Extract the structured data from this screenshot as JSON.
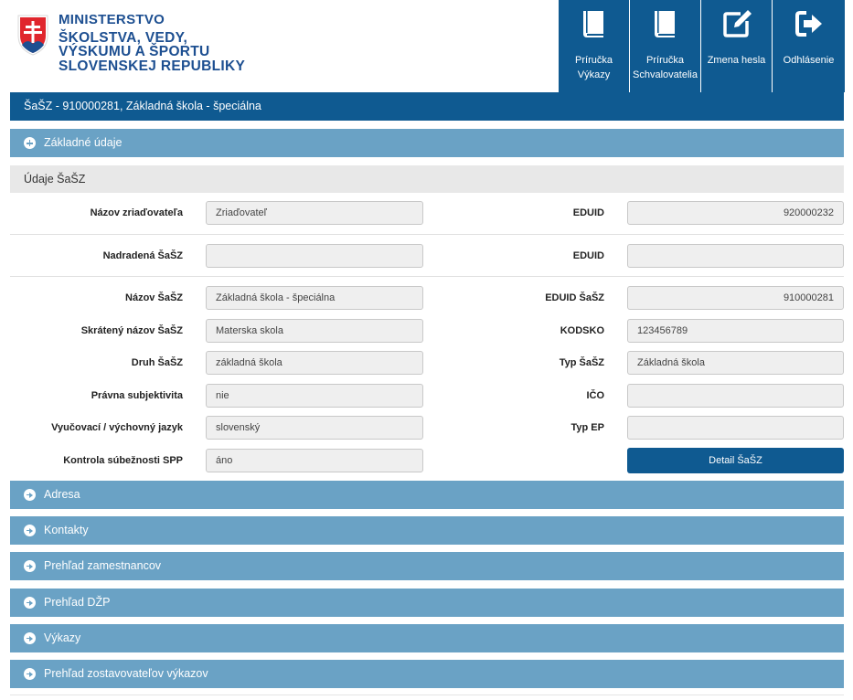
{
  "logo": {
    "line1": "MINISTERSTVO",
    "line2": "ŠKOLSTVA, VEDY,",
    "line3": "VÝSKUMU A ŠPORTU",
    "line4": "SLOVENSKEJ REPUBLIKY",
    "icon": "coat-of-arms-icon"
  },
  "topnav": [
    {
      "label1": "Príručka",
      "label2": "Výkazy",
      "icon": "book-icon"
    },
    {
      "label1": "Príručka",
      "label2": "Schvalovatelia",
      "icon": "book-icon"
    },
    {
      "label1": "Zmena hesla",
      "label2": "",
      "icon": "edit-icon"
    },
    {
      "label1": "Odhlásenie",
      "label2": "",
      "icon": "logout-icon"
    }
  ],
  "title": "ŠaŠZ - 910000281, Základná škola - špeciálna",
  "accordion_top": "Základné údaje",
  "section_title": "Údaje ŠaŠZ",
  "rows": {
    "zriad_label": "Názov zriaďovateľa",
    "zriad_value": "Zriaďovateľ",
    "euid1_label": "EDUID",
    "euid1_value": "920000232",
    "nadr_label": "Nadradená ŠaŠZ",
    "nadr_value": "",
    "euid2_label": "EDUID",
    "euid2_value": "",
    "nazov_label": "Názov ŠaŠZ",
    "nazov_value": "Základná škola - špeciálna",
    "euid3_label": "EDUID ŠaŠZ",
    "euid3_value": "910000281",
    "skrat_label": "Skrátený názov ŠaŠZ",
    "skrat_value": "Materska skola",
    "kodsko_label": "KODSKO",
    "kodsko_value": "123456789",
    "druh_label": "Druh ŠaŠZ",
    "druh_value": "základná škola",
    "typ_label": "Typ ŠaŠZ",
    "typ_value": "Základná škola",
    "pravna_label": "Právna subjektivita",
    "pravna_value": "nie",
    "ico_label": "IČO",
    "ico_value": "",
    "jazyk_label": "Vyučovací / výchovný jazyk",
    "jazyk_value": "slovenský",
    "typep_label": "Typ EP",
    "typep_value": "",
    "kontrola_label": "Kontrola súbežnosti SPP",
    "kontrola_value": "áno",
    "detail_button": "Detail ŠaŠZ"
  },
  "accordions": [
    "Adresa",
    "Kontakty",
    "Prehľad zamestnancov",
    "Prehľad DŽP",
    "Výkazy",
    "Prehľad zostavovateľov výkazov"
  ],
  "colors": {
    "primary": "#0f5a91",
    "accordion": "#6aa2c5",
    "section": "#e8e8e8"
  }
}
